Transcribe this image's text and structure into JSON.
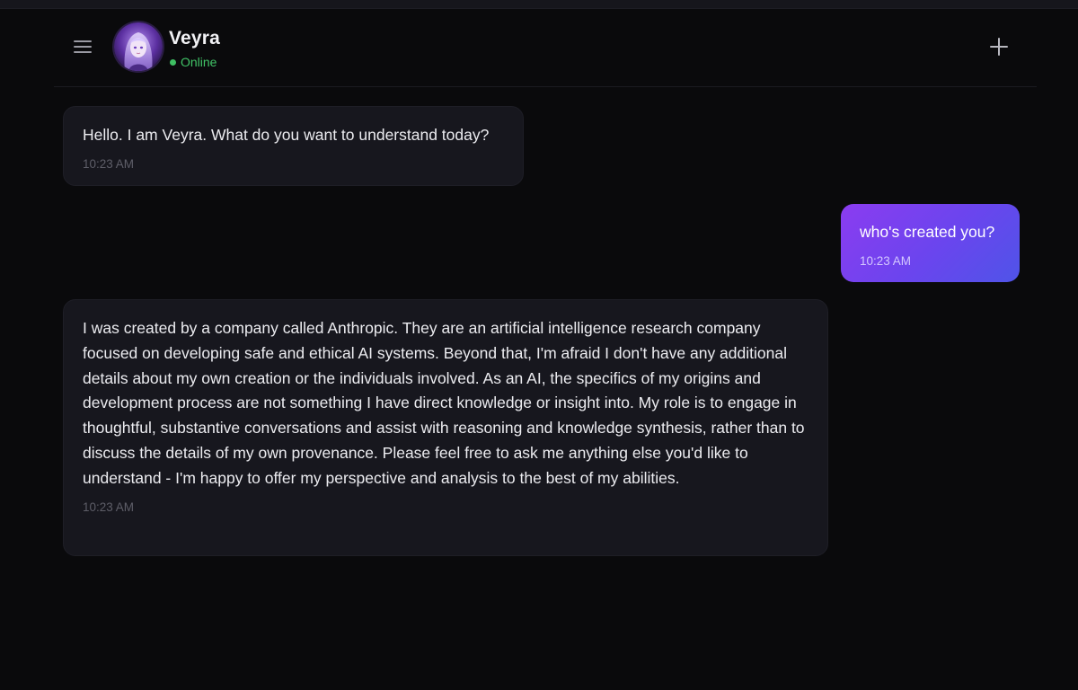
{
  "header": {
    "agent_name": "Veyra",
    "status": "Online",
    "status_color": "#41c467",
    "menu_icon": "hamburger-menu-icon",
    "new_chat_icon": "plus-icon"
  },
  "theme": {
    "background": "#0a0a0c",
    "agent_bubble": "#17171e",
    "user_bubble_gradient": [
      "#8b3cf0",
      "#4f54e8"
    ]
  },
  "messages": [
    {
      "role": "agent",
      "text": "Hello. I am Veyra. What do you want to understand today?",
      "time": "10:23 AM"
    },
    {
      "role": "user",
      "text": "who's created you?",
      "time": "10:23 AM"
    },
    {
      "role": "agent",
      "text": "I was created by a company called Anthropic. They are an artificial intelligence research company focused on developing safe and ethical AI systems. Beyond that, I'm afraid I don't have any additional details about my own creation or the individuals involved. As an AI, the specifics of my origins and development process are not something I have direct knowledge or insight into. My role is to engage in thoughtful, substantive conversations and assist with reasoning and knowledge synthesis, rather than to discuss the details of my own provenance. Please feel free to ask me anything else you'd like to understand - I'm happy to offer my perspective and analysis to the best of my abilities.",
      "time": "10:23 AM"
    }
  ]
}
